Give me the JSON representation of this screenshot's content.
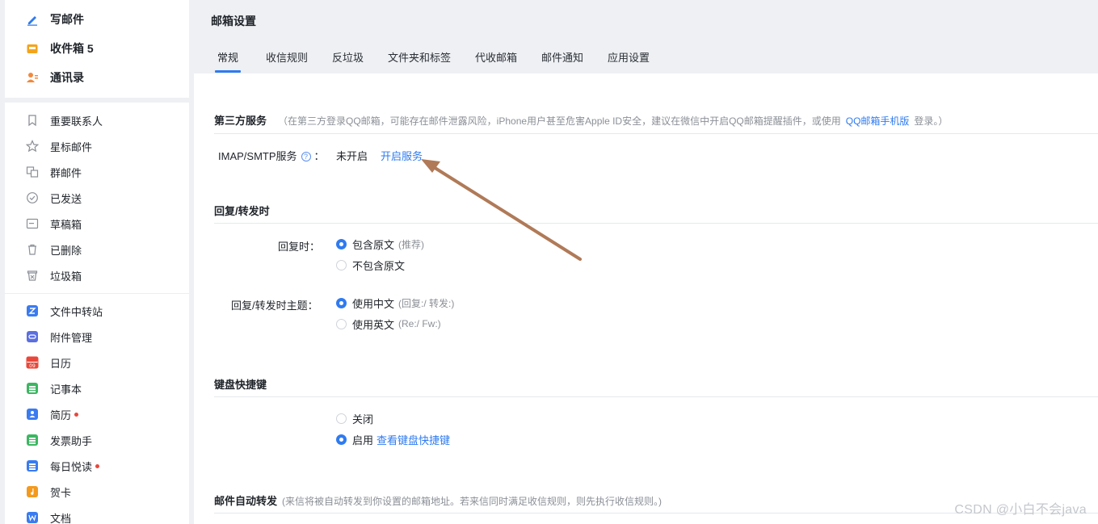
{
  "sidebar": {
    "top_items": [
      {
        "label": "写邮件",
        "icon": "pen-icon"
      },
      {
        "label": "收件箱 5",
        "icon": "inbox-icon"
      },
      {
        "label": "通讯录",
        "icon": "contacts-icon"
      }
    ],
    "items": [
      {
        "label": "重要联系人",
        "icon": "bookmark-icon"
      },
      {
        "label": "星标邮件",
        "icon": "star-icon"
      },
      {
        "label": "群邮件",
        "icon": "group-mail-icon"
      },
      {
        "label": "已发送",
        "icon": "check-circle-icon"
      },
      {
        "label": "草稿箱",
        "icon": "draft-icon"
      },
      {
        "label": "已删除",
        "icon": "trash-icon"
      },
      {
        "label": "垃圾箱",
        "icon": "junk-icon"
      },
      {
        "label": "文件中转站",
        "icon": "file-transfer-icon",
        "color": "#3a7bf0"
      },
      {
        "label": "附件管理",
        "icon": "attachment-icon",
        "color": "#5b6fe0"
      },
      {
        "label": "日历",
        "icon": "calendar-icon",
        "color": "#e8483b",
        "badge_text": "09"
      },
      {
        "label": "记事本",
        "icon": "notepad-icon",
        "color": "#3cb661"
      },
      {
        "label": "简历",
        "icon": "resume-icon",
        "color": "#3a7bf0",
        "dot": true
      },
      {
        "label": "发票助手",
        "icon": "invoice-icon",
        "color": "#3cb661"
      },
      {
        "label": "每日悦读",
        "icon": "daily-read-icon",
        "color": "#3a7bf0",
        "dot": true
      },
      {
        "label": "贺卡",
        "icon": "greeting-card-icon",
        "color": "#f39a1e"
      },
      {
        "label": "文档",
        "icon": "document-icon",
        "color": "#3a7bf0"
      }
    ]
  },
  "header": {
    "title": "邮箱设置",
    "tabs": [
      {
        "label": "常规",
        "active": true
      },
      {
        "label": "收信规则"
      },
      {
        "label": "反垃圾"
      },
      {
        "label": "文件夹和标签"
      },
      {
        "label": "代收邮箱"
      },
      {
        "label": "邮件通知"
      },
      {
        "label": "应用设置"
      }
    ]
  },
  "third_party": {
    "title": "第三方服务",
    "note_prefix": "（在第三方登录QQ邮箱，可能存在邮件泄露风险，iPhone用户甚至危害Apple ID安全，建议在微信中开启QQ邮箱提醒插件，或使用",
    "note_link": "QQ邮箱手机版",
    "note_suffix": "登录。）",
    "imap_label": "IMAP/SMTP服务",
    "help_glyph": "?",
    "colon": "：",
    "status": "未开启",
    "enable_link": "开启服务"
  },
  "reply": {
    "title": "回复/转发时",
    "reply_label": "回复时：",
    "option_include": "包含原文",
    "option_include_hint": "(推荐)",
    "option_exclude": "不包含原文",
    "subject_label": "回复/转发时主题：",
    "option_chinese": "使用中文",
    "option_chinese_hint": "(回复:/ 转发:)",
    "option_english": "使用英文",
    "option_english_hint": "(Re:/ Fw:)"
  },
  "keyboard": {
    "title": "键盘快捷键",
    "option_off": "关闭",
    "option_on": "启用",
    "view_link": "查看键盘快捷键"
  },
  "forward": {
    "title": "邮件自动转发",
    "note": "(来信将被自动转发到你设置的邮箱地址。若来信同时满足收信规则，则先执行收信规则。)"
  },
  "watermark": "CSDN @小白不会java",
  "colors": {
    "accent": "#2f7bf0",
    "annotation_arrow": "#b07a58"
  }
}
